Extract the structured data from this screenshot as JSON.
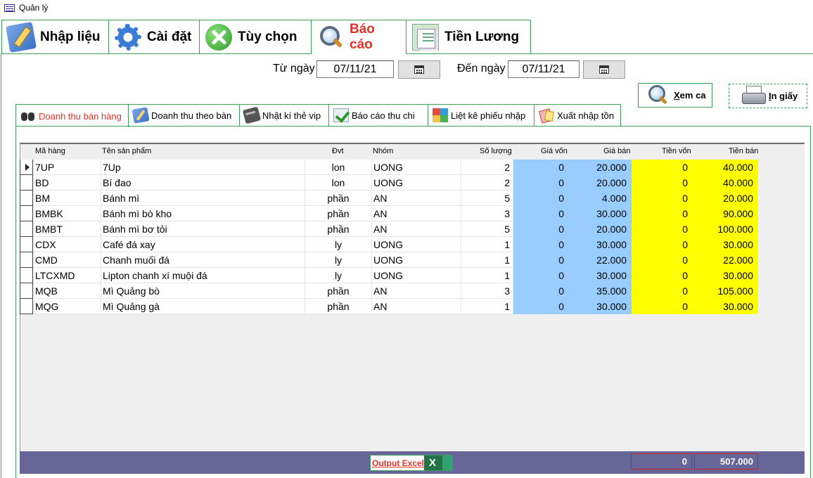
{
  "window": {
    "title": "Quản lý"
  },
  "top_tabs": [
    {
      "label": "Nhập liệu",
      "icon": "pencil-ruler-icon"
    },
    {
      "label": "Cài đặt",
      "icon": "gear-icon"
    },
    {
      "label": "Tùy chọn",
      "icon": "tools-icon"
    },
    {
      "label": "Báo cáo",
      "icon": "magnifier-icon",
      "active": true
    },
    {
      "label": "Tiền Lương",
      "icon": "money-sheet-icon"
    }
  ],
  "filters": {
    "from_label": "Từ ngày",
    "from_value": "07/11/21",
    "to_label": "Đến ngày",
    "to_value": "07/11/21"
  },
  "actions": {
    "view_label": "Xem ca",
    "print_label": "In giấy"
  },
  "sub_tabs": [
    {
      "label": "Doanh thu bán hàng",
      "icon": "binoculars-icon",
      "active": true
    },
    {
      "label": "Doanh thu theo bàn",
      "icon": "pencil-icon"
    },
    {
      "label": "Nhật kí thẻ vip",
      "icon": "card-icon"
    },
    {
      "label": "Báo cáo thu chi",
      "icon": "checklist-icon"
    },
    {
      "label": "Liệt kê phiếu nhập",
      "icon": "grid-icon"
    },
    {
      "label": "Xuất nhập tồn",
      "icon": "cards-icon"
    }
  ],
  "table": {
    "headers": [
      "Mã hàng",
      "Tên sản phẩm",
      "Đvt",
      "Nhóm",
      "Số lượng",
      "Giá vốn",
      "Giá bán",
      "Tiền vốn",
      "Tiền bán"
    ],
    "rows": [
      [
        "7UP",
        "7Up",
        "lon",
        "UONG",
        "2",
        "0",
        "20.000",
        "0",
        "40.000"
      ],
      [
        "BD",
        "Bí đao",
        "lon",
        "UONG",
        "2",
        "0",
        "20.000",
        "0",
        "40.000"
      ],
      [
        "BM",
        "Bánh mì",
        "phần",
        "AN",
        "5",
        "0",
        "4.000",
        "0",
        "20.000"
      ],
      [
        "BMBK",
        "Bánh mì bò kho",
        "phần",
        "AN",
        "3",
        "0",
        "30.000",
        "0",
        "90.000"
      ],
      [
        "BMBT",
        "Bánh mì bơ tỏi",
        "phần",
        "AN",
        "5",
        "0",
        "20.000",
        "0",
        "100.000"
      ],
      [
        "CDX",
        "Café đá xay",
        "ly",
        "UONG",
        "1",
        "0",
        "30.000",
        "0",
        "30.000"
      ],
      [
        "CMD",
        "Chanh muối đá",
        "ly",
        "UONG",
        "1",
        "0",
        "22.000",
        "0",
        "22.000"
      ],
      [
        "LTCXMD",
        "Lipton chanh xí muội đá",
        "ly",
        "UONG",
        "1",
        "0",
        "30.000",
        "0",
        "30.000"
      ],
      [
        "MQB",
        "Mì Quảng bò",
        "phần",
        "AN",
        "3",
        "0",
        "35.000",
        "0",
        "105.000"
      ],
      [
        "MQG",
        "Mì Quảng gà",
        "phần",
        "AN",
        "1",
        "0",
        "30.000",
        "0",
        "30.000"
      ]
    ]
  },
  "footer": {
    "excel_label": "Output Excel",
    "excel_icon_text": "X",
    "total_cost": "0",
    "total_sales": "507.000"
  },
  "colors": {
    "accent_border": "#3aa35b",
    "active_tab_text": "#e0342b",
    "cost_columns": "#99ccff",
    "money_columns": "#ffff00",
    "footer_bar": "#686699"
  }
}
